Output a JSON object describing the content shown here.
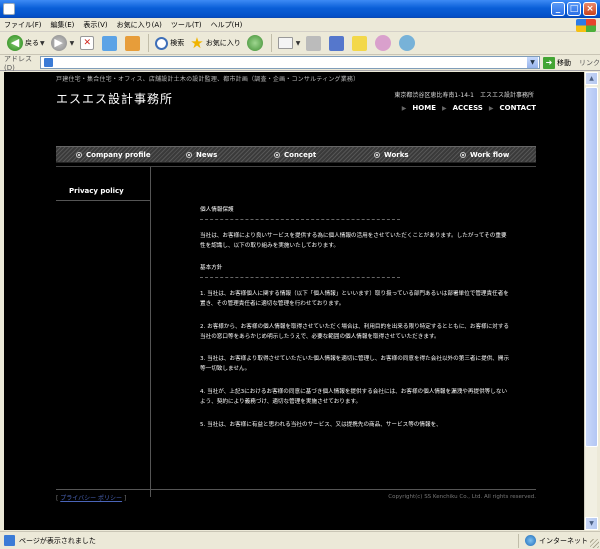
{
  "window": {
    "title": "",
    "min_label": "_",
    "max_label": "□",
    "close_label": "×"
  },
  "menubar": {
    "items": [
      "ファイル(F)",
      "編集(E)",
      "表示(V)",
      "お気に入り(A)",
      "ツール(T)",
      "ヘルプ(H)"
    ]
  },
  "toolbar": {
    "back_label": "戻る",
    "search_label": "検索",
    "favorites_label": "お気に入り"
  },
  "addressbar": {
    "label": "アドレス(D)",
    "value": "",
    "go_label": "移動",
    "links_label": "リンク"
  },
  "site": {
    "tagline": "戸建住宅・集合住宅・オフィス、店舗設計土木の設計監理、都市計画（調査・企画・コンサルティング業務）",
    "logo": "エスエス設計事務所",
    "address": "東京都渋谷区恵比寿南1-14-1　エスエス設計事務所",
    "topnav": [
      "HOME",
      "ACCESS",
      "CONTACT"
    ],
    "globalnav": [
      "Company profile",
      "News",
      "Concept",
      "Works",
      "Work flow"
    ],
    "sidebar_title": "Privacy policy",
    "content": {
      "heading": "個人情報保護",
      "intro": "当社は、お客様により良いサービスを提供する為に個人情報の活用をさせていただくことがあります。したがってその重要性を認識し、以下の取り組みを実施いたしております。",
      "policy_heading": "基本方針",
      "items": [
        "1. 当社は、お客様個人に関する情報（以下「個人情報」といいます）取り扱っている部門あるいは部署単位で管理責任者を置き、その管理責任者に適切な管理を行わせております。",
        "2. お客様から、お客様の個人情報を取得させていただく場合は、利用目的を出来る限り特定するとともに、お客様に対する当社の窓口等をあらかじめ明示したうえで、必要な範囲の個人情報を取得させていただきます。",
        "3. 当社は、お客様より取得させていただいた個人情報を適切に管理し、お客様の同意を得た会社以外の第三者に提供、開示等一切致しません。",
        "4. 当社が、上記3におけるお客様の同意に基づき個人情報を提供する会社には、お客様の個人情報を漏洩や再提供等しないよう、契約により義務づけ、適切な管理を実施させております。",
        "5. 当社は、お客様に有益と思われる当社のサービス、又は提携先の商品、サービス等の情報を、"
      ]
    },
    "footer": {
      "link_open": "[",
      "link_text": "プライバシー ポリシー",
      "link_close": "]",
      "copyright": "Copyright(c) SS Kenchiku Co., Ltd. All rights reserved."
    }
  },
  "statusbar": {
    "status": "ページが表示されました",
    "zone": "インターネット"
  }
}
